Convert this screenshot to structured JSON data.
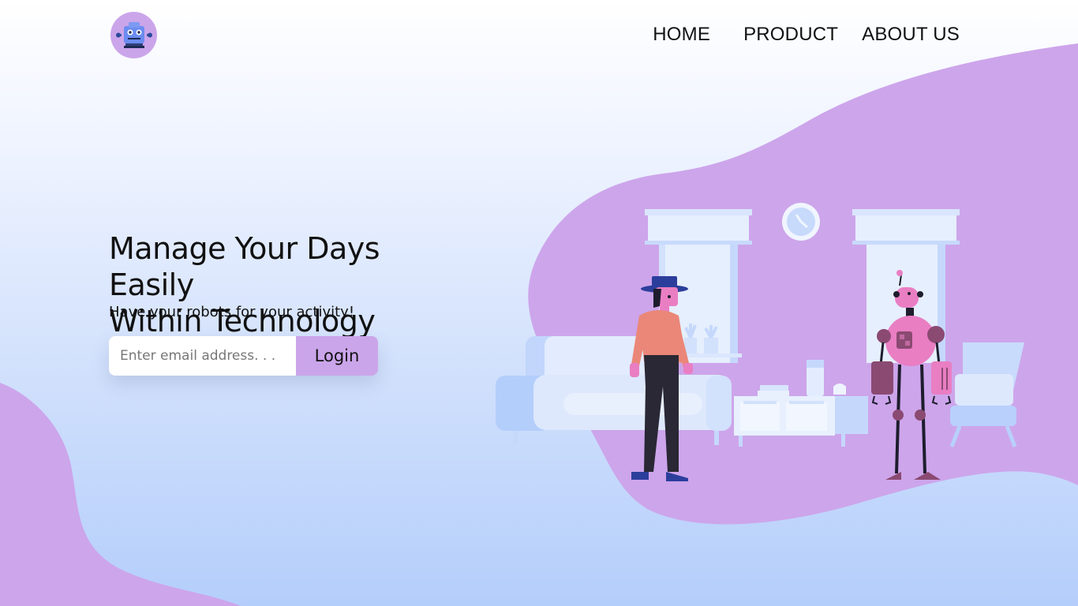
{
  "colors": {
    "accent": "#cba5ea",
    "blob": "#cda5eb",
    "text": "#111111",
    "input_bg": "#ffffff",
    "bg_top": "#ffffff",
    "bg_bottom": "#b4cefb"
  },
  "header": {
    "logo_icon": "robot-icon",
    "nav": {
      "home": "HOME",
      "product": "PRODUCT",
      "about": "ABOUT US"
    }
  },
  "hero": {
    "title_line1": "Manage Your Days Easily",
    "title_line2": "Within Technology",
    "subtitle": "Have your robots for your activity!",
    "email_placeholder": "Enter email address. . .",
    "login_label": "Login"
  },
  "illustration": {
    "icon": "living-room-robot-illustration"
  }
}
